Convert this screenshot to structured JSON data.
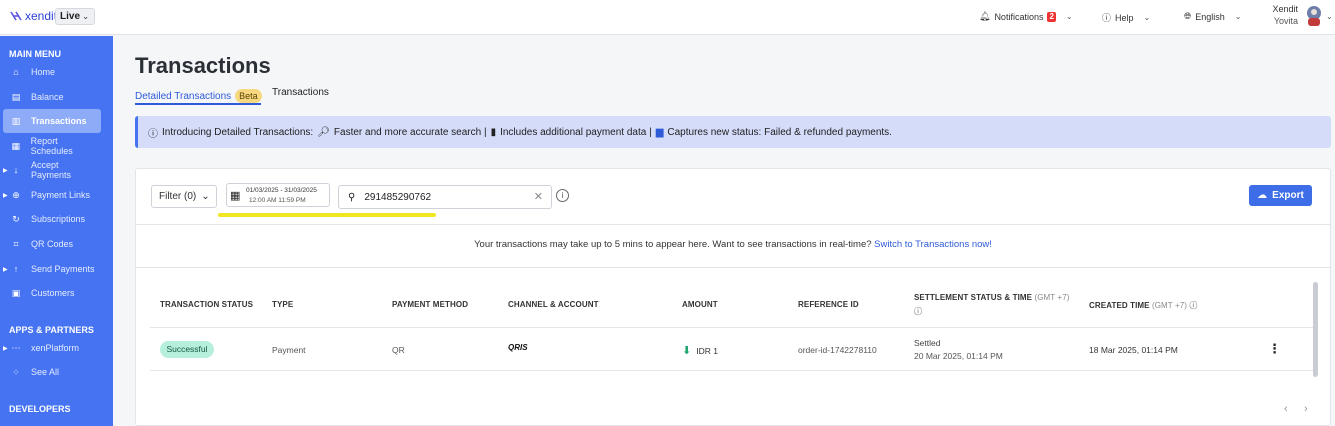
{
  "brand": {
    "name": "xendit",
    "env": "Live"
  },
  "topbar": {
    "notifications_label": "Notifications",
    "notifications_count": "2",
    "help_label": "Help",
    "language_label": "English",
    "user_company": "Xendit",
    "user_name": "Yovita"
  },
  "sidebar": {
    "main_menu_title": "MAIN MENU",
    "items": [
      {
        "label": "Home",
        "icon": "home-icon"
      },
      {
        "label": "Balance",
        "icon": "balance-icon"
      },
      {
        "label": "Transactions",
        "icon": "transactions-icon"
      },
      {
        "label": "Report Schedules",
        "icon": "report-icon"
      },
      {
        "label": "Accept Payments",
        "icon": "accept-payments-icon"
      },
      {
        "label": "Payment Links",
        "icon": "payment-links-icon"
      },
      {
        "label": "Subscriptions",
        "icon": "subscriptions-icon"
      },
      {
        "label": "QR Codes",
        "icon": "qr-icon"
      },
      {
        "label": "Send Payments",
        "icon": "send-payments-icon"
      },
      {
        "label": "Customers",
        "icon": "customers-icon"
      }
    ],
    "apps_title": "APPS & PARTNERS",
    "apps_items": [
      {
        "label": "xenPlatform",
        "icon": "xenplatform-icon"
      },
      {
        "label": "See All",
        "icon": "grid-icon"
      }
    ],
    "developers_title": "DEVELOPERS"
  },
  "page": {
    "title": "Transactions",
    "tab_detailed": "Detailed Transactions",
    "tab_beta": "Beta",
    "tab_transactions": "Transactions"
  },
  "banner": {
    "intro": "Introducing Detailed Transactions:",
    "item1": "Faster and more accurate search |",
    "item2": "Includes additional payment data |",
    "item3": "Captures new status: Failed & refunded payments."
  },
  "toolbar": {
    "filter_label": "Filter (0)",
    "date_range_top": "01/03/2025  -  31/03/2025",
    "date_range_bottom": "12:00 AM          11:59 PM",
    "search_value": "291485290762",
    "export_label": "Export"
  },
  "notice": {
    "text": "Your transactions may take up to 5 mins to appear here. Want to see transactions in real-time?",
    "link": "Switch to Transactions now!"
  },
  "table": {
    "headers": {
      "status": "TRANSACTION STATUS",
      "type": "TYPE",
      "method": "PAYMENT METHOD",
      "channel": "CHANNEL & ACCOUNT",
      "amount": "AMOUNT",
      "reference": "REFERENCE ID",
      "settlement": "SETTLEMENT STATUS & TIME",
      "settlement_tz": "(GMT +7)",
      "created": "CREATED TIME",
      "created_tz": "(GMT +7)"
    },
    "rows": [
      {
        "status": "Successful",
        "type": "Payment",
        "method": "QR",
        "channel": "QRIS",
        "amount": "IDR 1",
        "reference": "order-id-1742278110",
        "settlement_status": "Settled",
        "settlement_time": "20 Mar 2025, 01:14 PM",
        "created_time": "18 Mar 2025, 01:14 PM"
      }
    ]
  },
  "colors": {
    "sidebar": "#4573f2",
    "accent": "#3e6de8",
    "success_bg": "#b6efdc",
    "highlight": "#f2e521"
  }
}
